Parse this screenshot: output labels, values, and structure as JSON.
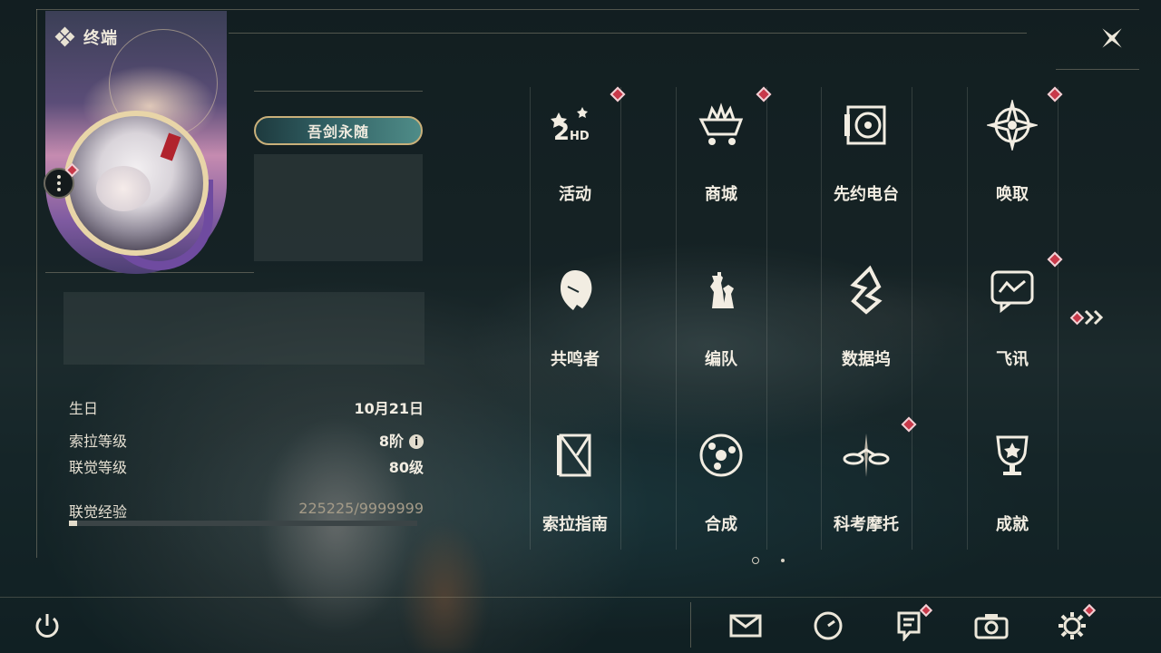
{
  "window": {
    "title": "终端"
  },
  "profile": {
    "nickname": "吾剑永随",
    "stats": [
      {
        "label": "生日",
        "value": "10月21日"
      },
      {
        "label": "索拉等级",
        "value": "8阶"
      },
      {
        "label": "联觉等级",
        "value": "80级"
      }
    ],
    "experience": {
      "label": "联觉经验",
      "value": "225225/9999999",
      "fraction": 0.0225
    }
  },
  "menu": {
    "items": [
      {
        "label": "活动",
        "icon": "events-2hd-icon",
        "badge": true
      },
      {
        "label": "商城",
        "icon": "shop-cart-icon",
        "badge": true
      },
      {
        "label": "先约电台",
        "icon": "radio-icon",
        "badge": false
      },
      {
        "label": "唤取",
        "icon": "convene-compass-icon",
        "badge": true
      },
      {
        "label": "共鸣者",
        "icon": "resonator-head-icon",
        "badge": false
      },
      {
        "label": "编队",
        "icon": "team-chess-icon",
        "badge": false
      },
      {
        "label": "数据坞",
        "icon": "databank-icon",
        "badge": false
      },
      {
        "label": "飞讯",
        "icon": "chat-message-icon",
        "badge": true
      },
      {
        "label": "索拉指南",
        "icon": "guidebook-icon",
        "badge": false
      },
      {
        "label": "合成",
        "icon": "synthesis-icon",
        "badge": false
      },
      {
        "label": "科考摩托",
        "icon": "motorcycle-icon",
        "badge": true
      },
      {
        "label": "成就",
        "icon": "trophy-icon",
        "badge": false
      }
    ],
    "page_count": 2,
    "current_page": 1
  },
  "bottom_bar": {
    "buttons": [
      {
        "icon": "mail-icon",
        "badge": false
      },
      {
        "icon": "clock-icon",
        "badge": false
      },
      {
        "icon": "notice-icon",
        "badge": true
      },
      {
        "icon": "camera-icon",
        "badge": false
      },
      {
        "icon": "settings-gear-icon",
        "badge": true
      }
    ]
  },
  "colors": {
    "badge": "#c8394a",
    "text": "#f2ede2",
    "accent_gold": "#c9b07a"
  }
}
